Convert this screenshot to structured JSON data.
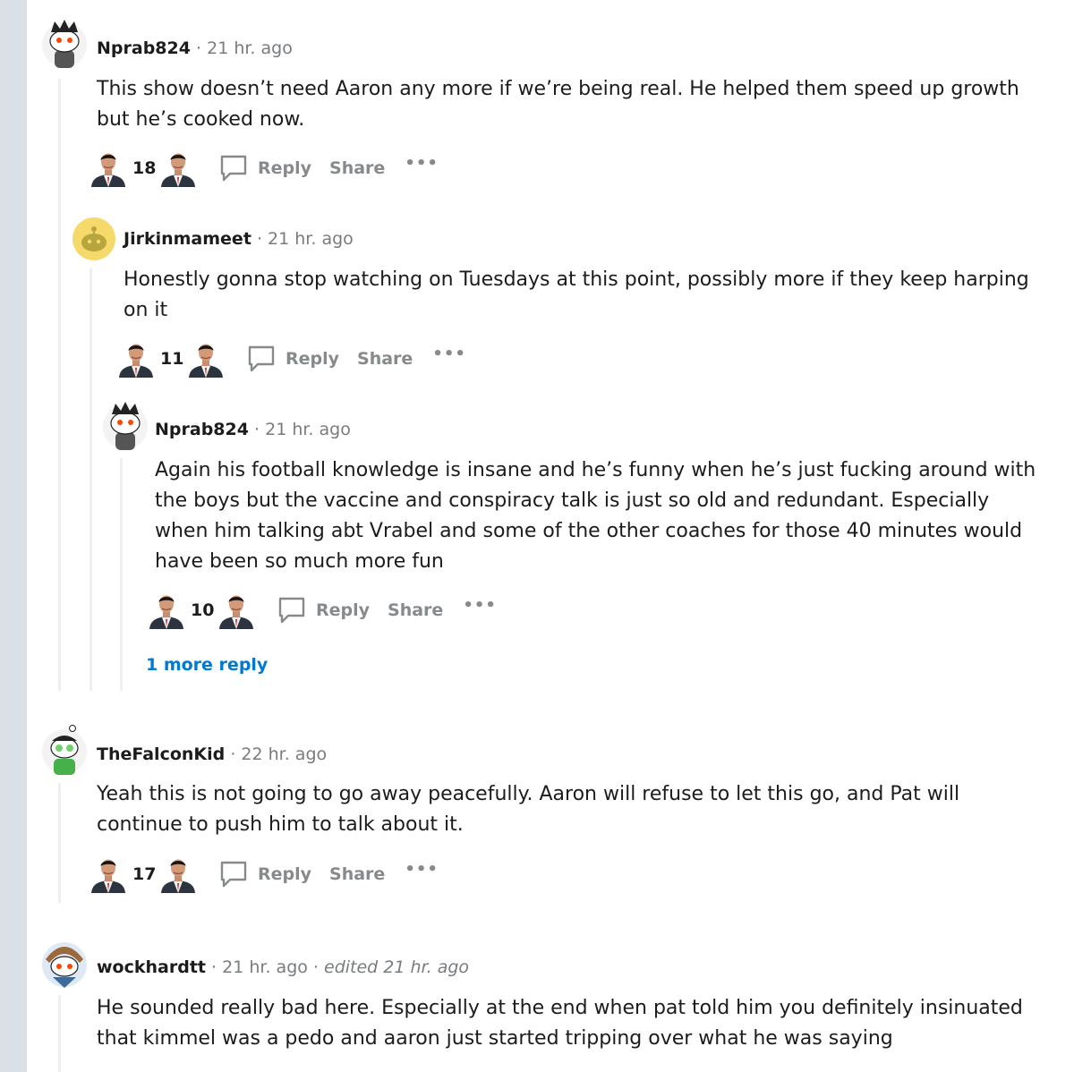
{
  "comments": [
    {
      "username": "Nprab824",
      "time": "21 hr. ago",
      "body": "This show doesn’t need Aaron any more if we’re being real. He helped them speed up growth but he’s cooked now.",
      "score": "18"
    },
    {
      "username": "Jirkinmameet",
      "time": "21 hr. ago",
      "body": "Honestly gonna stop watching on Tuesdays at this point, possibly more if they keep harping on it",
      "score": "11"
    },
    {
      "username": "Nprab824",
      "time": "21 hr. ago",
      "body": "Again his football knowledge is insane and he’s funny when he’s just fucking around with the boys but the vaccine and conspiracy talk is just so old and redundant. Especially when him talking abt Vrabel and some of the other coaches for those 40 minutes would have been so much more fun",
      "score": "10",
      "more_replies": "1 more reply"
    },
    {
      "username": "TheFalconKid",
      "time": "22 hr. ago",
      "body": "Yeah this is not going to go away peacefully. Aaron will refuse to let this go, and Pat will continue to push him to talk about it.",
      "score": "17"
    },
    {
      "username": "wockhardtt",
      "time": "21 hr. ago",
      "edited": "edited 21 hr. ago",
      "body": "He sounded really bad here. Especially at the end when pat told him you definitely insinuated that kimmel was a pedo and aaron just started tripping over what he was saying"
    }
  ],
  "labels": {
    "reply": "Reply",
    "share": "Share",
    "more": "•••",
    "separator": "·"
  },
  "icons": {
    "upvote": "upvote-icon",
    "downvote": "downvote-icon",
    "reply": "speech-bubble-icon",
    "more": "more-options-icon"
  },
  "colors": {
    "link": "#0079d3",
    "muted": "#878a8c",
    "sidebar": "#dae0e6"
  }
}
